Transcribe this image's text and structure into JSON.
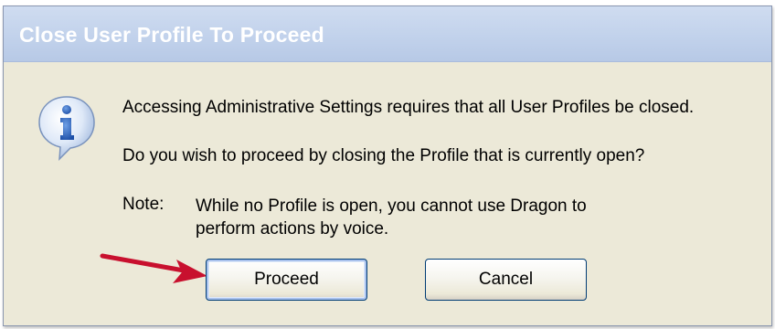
{
  "dialog": {
    "title": "Close User Profile To Proceed",
    "message_line1": "Accessing Administrative Settings requires that all User Profiles be closed.",
    "message_line2": "Do you wish to proceed by closing the Profile that is currently open?",
    "note_label": "Note:",
    "note_line1": "While no Profile is open, you cannot use Dragon to",
    "note_line2": "perform actions by voice.",
    "icon": "info-icon",
    "buttons": {
      "proceed_label": "Proceed",
      "cancel_label": "Cancel"
    }
  },
  "annotation": {
    "arrow_icon": "red-arrow-icon",
    "arrow_color": "#c8102e"
  },
  "colors": {
    "dialog_bg": "#ece9d8",
    "titlebar": "#c3d3ec",
    "title_text": "#ffffff",
    "button_border": "#003c74"
  }
}
